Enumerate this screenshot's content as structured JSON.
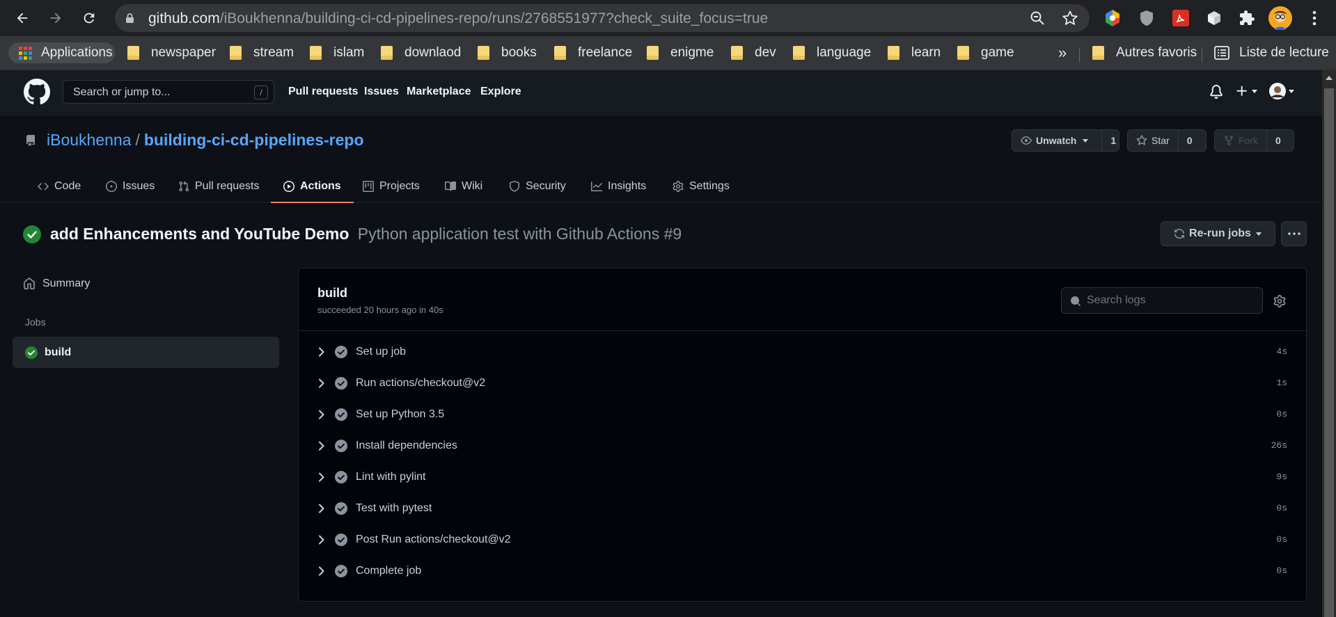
{
  "browser": {
    "url_host": "github.com",
    "url_path": "/iBoukhenna/building-ci-cd-pipelines-repo/runs/2768551977?check_suite_focus=true",
    "bookmarks": {
      "apps": "Applications",
      "items": [
        "newspaper",
        "stream",
        "islam",
        "downlaod",
        "books",
        "freelance",
        "enigme",
        "dev",
        "language",
        "learn",
        "game"
      ],
      "overflow": "»",
      "other": "Autres favoris",
      "reading_list": "Liste de lecture"
    }
  },
  "gh_header": {
    "search_placeholder": "Search or jump to...",
    "search_shortcut": "/",
    "nav": [
      "Pull requests",
      "Issues",
      "Marketplace",
      "Explore"
    ]
  },
  "repo": {
    "owner": "iBoukhenna",
    "separator": "/",
    "name": "building-ci-cd-pipelines-repo",
    "watch": {
      "label": "Unwatch",
      "count": "1"
    },
    "star": {
      "label": "Star",
      "count": "0"
    },
    "fork": {
      "label": "Fork",
      "count": "0"
    },
    "tabs": [
      "Code",
      "Issues",
      "Pull requests",
      "Actions",
      "Projects",
      "Wiki",
      "Security",
      "Insights",
      "Settings"
    ],
    "active_tab": "Actions"
  },
  "run": {
    "commit_title": "add Enhancements and YouTube Demo",
    "workflow": "Python application test with Github Actions #9",
    "rerun_label": "Re-run jobs"
  },
  "sidebar": {
    "summary": "Summary",
    "jobs_heading": "Jobs",
    "jobs": [
      "build"
    ]
  },
  "job": {
    "name": "build",
    "meta": "succeeded 20 hours ago in 40s",
    "search_placeholder": "Search logs",
    "steps": [
      {
        "label": "Set up job",
        "duration": "4s"
      },
      {
        "label": "Run actions/checkout@v2",
        "duration": "1s"
      },
      {
        "label": "Set up Python 3.5",
        "duration": "0s"
      },
      {
        "label": "Install dependencies",
        "duration": "26s"
      },
      {
        "label": "Lint with pylint",
        "duration": "9s"
      },
      {
        "label": "Test with pytest",
        "duration": "0s"
      },
      {
        "label": "Post Run actions/checkout@v2",
        "duration": "0s"
      },
      {
        "label": "Complete job",
        "duration": "0s"
      }
    ]
  },
  "colors": {
    "success": "#238636",
    "link": "#58a6ff",
    "active_tab_underline": "#f78166"
  }
}
